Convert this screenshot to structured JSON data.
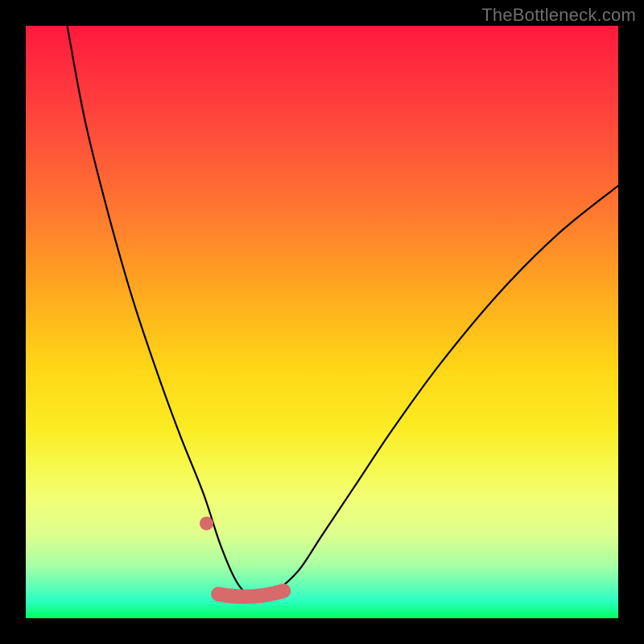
{
  "watermark": "TheBottleneck.com",
  "colors": {
    "frame": "#000000",
    "curve": "#000000",
    "marker": "#d76a6a"
  },
  "chart_data": {
    "type": "line",
    "title": "",
    "xlabel": "",
    "ylabel": "",
    "xlim": [
      0,
      100
    ],
    "ylim": [
      0,
      100
    ],
    "grid": false,
    "legend": false,
    "x_minimum": 36,
    "series": [
      {
        "name": "bottleneck-curve",
        "x": [
          7,
          10,
          14,
          18,
          22,
          26,
          30,
          33,
          36,
          39,
          42,
          46,
          50,
          56,
          62,
          70,
          80,
          90,
          100
        ],
        "y": [
          100,
          84,
          68,
          54,
          42,
          31,
          21,
          12,
          5.5,
          3.5,
          4.5,
          8,
          14,
          23,
          32,
          43,
          55,
          65,
          73
        ]
      }
    ],
    "markers": [
      {
        "type": "stray-dot",
        "x": 30.5,
        "y": 16
      },
      {
        "type": "band",
        "x_start": 32.5,
        "x_end": 43.5,
        "y": 3.8
      }
    ],
    "gradient_stops": [
      {
        "pos": 0.0,
        "color": "#ff1a3c"
      },
      {
        "pos": 0.5,
        "color": "#ffd716"
      },
      {
        "pos": 0.78,
        "color": "#f6f84a"
      },
      {
        "pos": 1.0,
        "color": "#00ff62"
      }
    ]
  }
}
